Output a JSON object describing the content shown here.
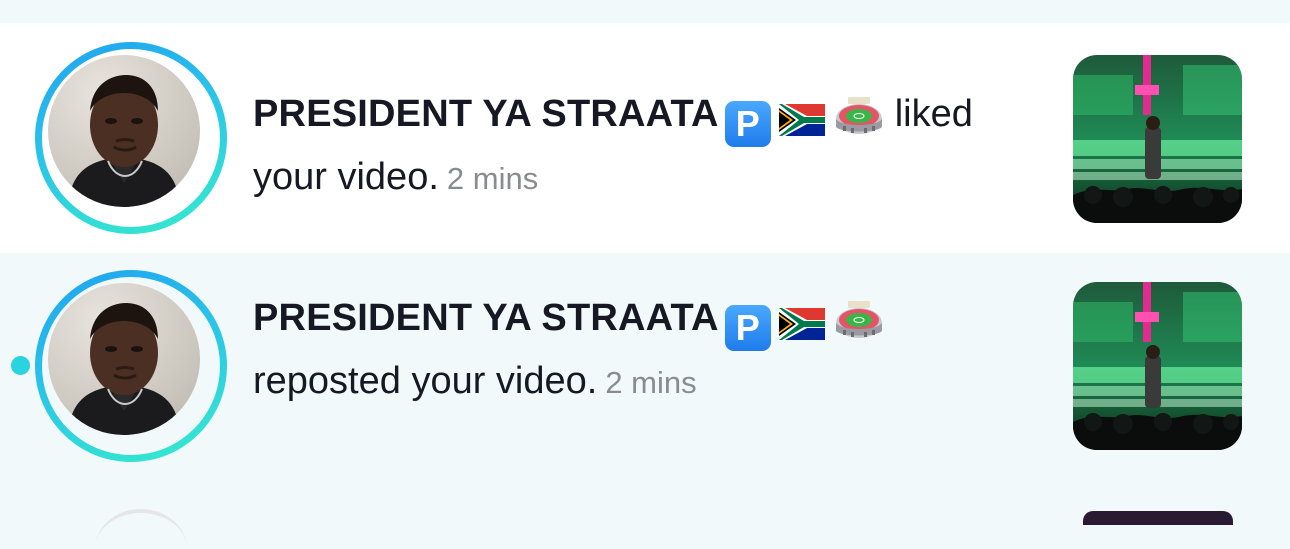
{
  "notifications": [
    {
      "user_name": "PRESIDENT YA STRAATA",
      "badges": [
        "p-button-icon",
        "south-africa-flag-icon",
        "stadium-icon"
      ],
      "action_text": "liked",
      "action_continuation": "your video.",
      "time_ago": "2 mins",
      "unread": false
    },
    {
      "user_name": "PRESIDENT YA STRAATA",
      "badges": [
        "p-button-icon",
        "south-africa-flag-icon",
        "stadium-icon"
      ],
      "action_text": "reposted your video.",
      "time_ago": "2 mins",
      "unread": true
    }
  ],
  "badge_p_letter": "P",
  "colors": {
    "ring_gradient_start": "#1fa2f0",
    "ring_gradient_end": "#37eccc",
    "unread_dot": "#2ad3e0",
    "time_text": "#8a8b91",
    "primary_text": "#161823",
    "row_highlight": "#f1f9fb"
  }
}
